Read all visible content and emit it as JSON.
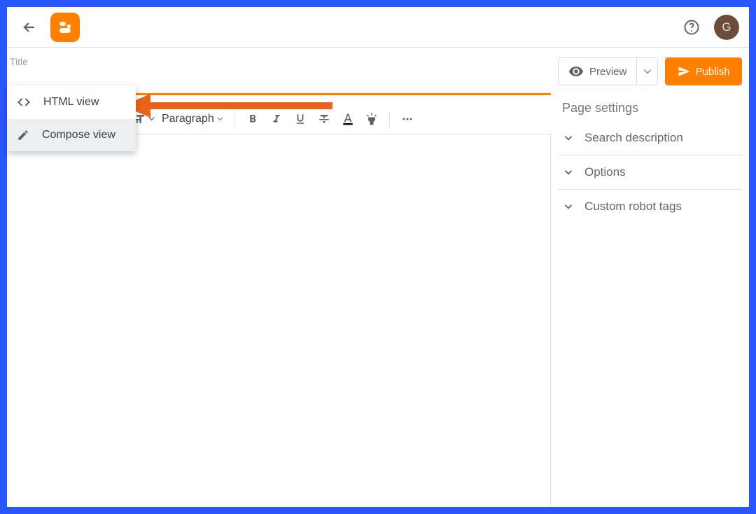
{
  "header": {
    "avatar_letter": "G"
  },
  "editor": {
    "title_label": "Title",
    "title_value": "",
    "toolbar": {
      "paragraph_label": "Paragraph"
    }
  },
  "view_menu": {
    "html_view": "HTML view",
    "compose_view": "Compose view"
  },
  "side": {
    "preview_label": "Preview",
    "publish_label": "Publish",
    "settings_title": "Page settings",
    "search_description": "Search description",
    "options": "Options",
    "custom_robot_tags": "Custom robot tags"
  }
}
